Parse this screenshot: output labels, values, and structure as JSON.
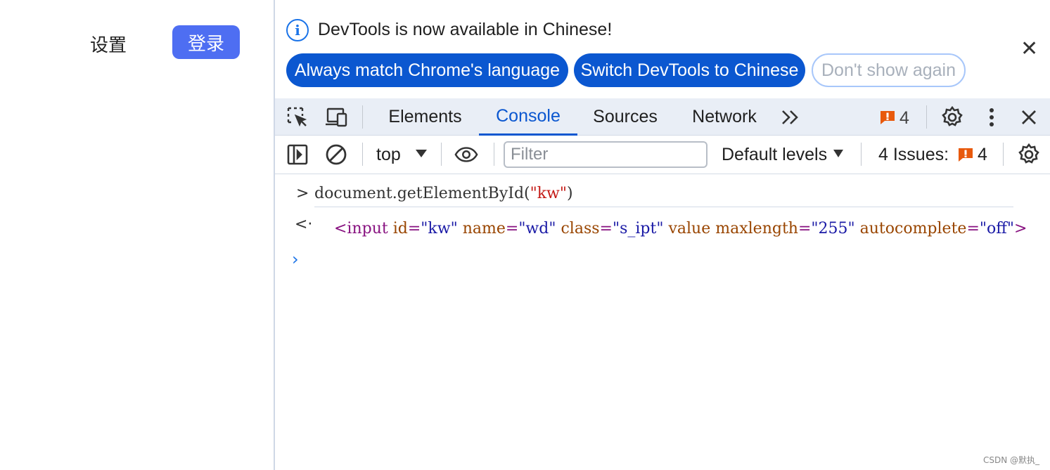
{
  "page": {
    "settings_label": "设置",
    "login_label": "登录",
    "login_color": "#4e6ef2"
  },
  "infobar": {
    "icon": "info-icon",
    "message": "DevTools is now available in Chinese!",
    "buttons": {
      "always_match": "Always match Chrome's language",
      "switch": "Switch DevTools to Chinese",
      "dont_show": "Don't show again"
    },
    "close_icon": "close-icon"
  },
  "tabbar": {
    "tabs": [
      "Elements",
      "Console",
      "Sources",
      "Network"
    ],
    "active_tab": "Console",
    "more_tabs_icon": "chevron-double-right-icon",
    "issues_count": "4",
    "accent": "#0b57d0"
  },
  "console_toolbar": {
    "context": "top",
    "filter_placeholder": "Filter",
    "levels": "Default levels",
    "issues_label": "4 Issues:",
    "issues_count": "4"
  },
  "console": {
    "input": {
      "fn": "document.getElementById(",
      "arg": "\"kw\"",
      "close": ")"
    },
    "output": {
      "open": "<input",
      "attrs": [
        {
          "name": "id",
          "value": "\"kw\""
        },
        {
          "name": "name",
          "value": "\"wd\""
        },
        {
          "name": "class",
          "value": "\"s_ipt\""
        },
        {
          "name": "value",
          "value": ""
        },
        {
          "name": "maxlength",
          "value": "\"255\""
        },
        {
          "name": "autocomplete",
          "value": "\"off\""
        }
      ],
      "close": ">"
    }
  },
  "watermark": "CSDN @默执_"
}
